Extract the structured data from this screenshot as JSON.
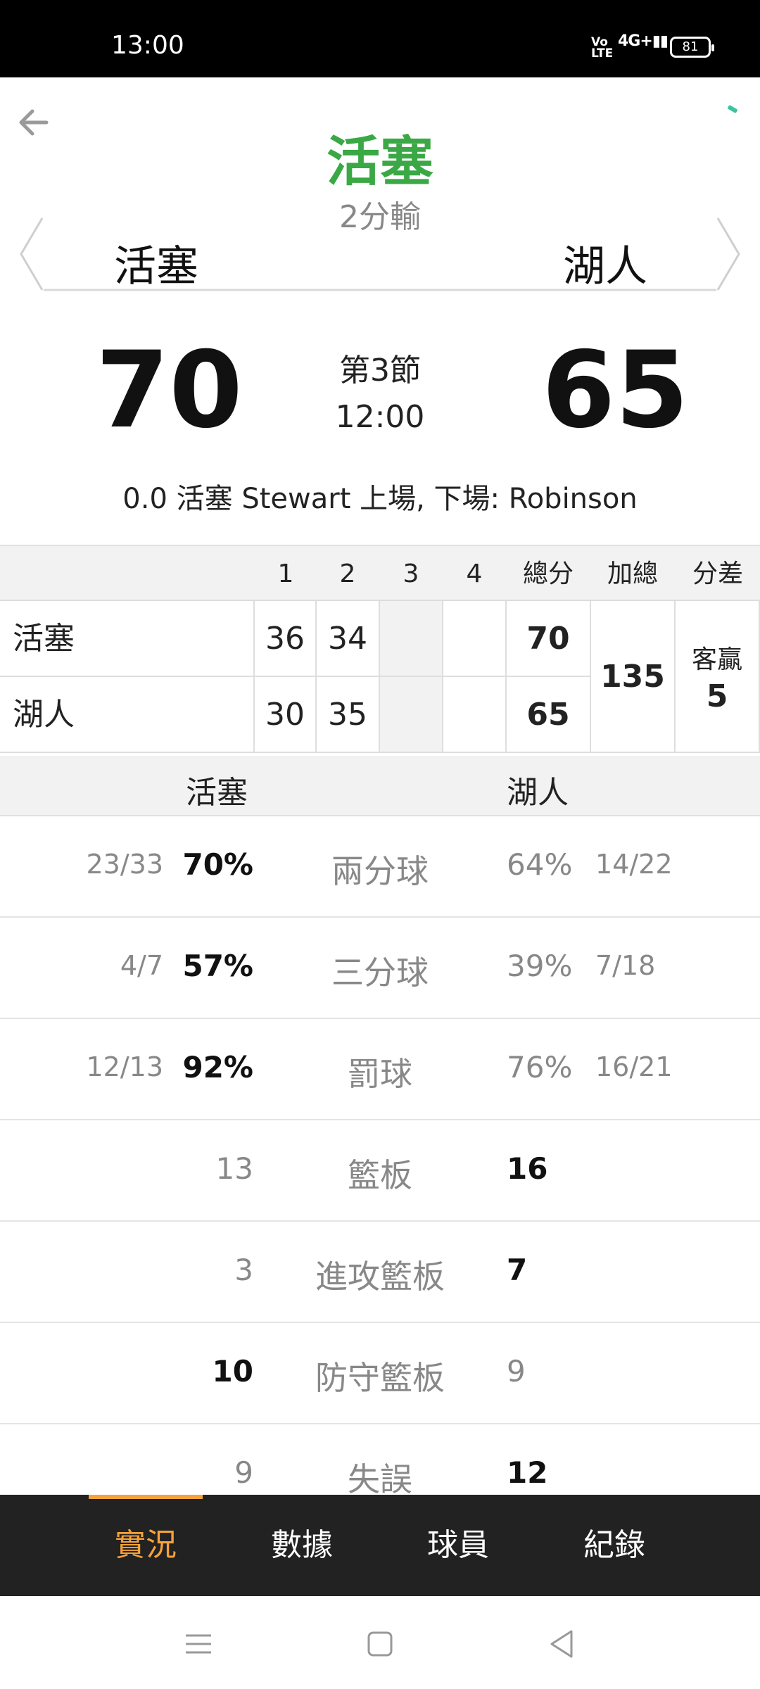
{
  "status_bar": {
    "time": "13:00",
    "volte": "Vo LTE",
    "network": "4G+",
    "battery": "81"
  },
  "header": {
    "leading_team": "活塞",
    "margin_text": "2分輸",
    "team_left": "活塞",
    "team_right": "湖人"
  },
  "score": {
    "left": "70",
    "right": "65",
    "period": "第3節",
    "clock": "12:00"
  },
  "event_text": "0.0 活塞 Stewart 上場, 下場: Robinson",
  "period_table": {
    "headers": [
      "1",
      "2",
      "3",
      "4",
      "總分",
      "加總",
      "分差"
    ],
    "rows": [
      {
        "team": "活塞",
        "q1": "36",
        "q2": "34",
        "q3": "",
        "q4": "",
        "total": "70"
      },
      {
        "team": "湖人",
        "q1": "30",
        "q2": "35",
        "q3": "",
        "q4": "",
        "total": "65"
      }
    ],
    "sum": "135",
    "diff_label": "客贏",
    "diff_value": "5"
  },
  "stats": {
    "team_left": "活塞",
    "team_right": "湖人",
    "rows": [
      {
        "label": "兩分球",
        "left_frac": "23/33",
        "left_val": "70%",
        "right_val": "64%",
        "right_frac": "14/22",
        "lead": "left"
      },
      {
        "label": "三分球",
        "left_frac": "4/7",
        "left_val": "57%",
        "right_val": "39%",
        "right_frac": "7/18",
        "lead": "left"
      },
      {
        "label": "罰球",
        "left_frac": "12/13",
        "left_val": "92%",
        "right_val": "76%",
        "right_frac": "16/21",
        "lead": "left"
      },
      {
        "label": "籃板",
        "left_frac": "",
        "left_val": "13",
        "right_val": "16",
        "right_frac": "",
        "lead": "right"
      },
      {
        "label": "進攻籃板",
        "left_frac": "",
        "left_val": "3",
        "right_val": "7",
        "right_frac": "",
        "lead": "right"
      },
      {
        "label": "防守籃板",
        "left_frac": "",
        "left_val": "10",
        "right_val": "9",
        "right_frac": "",
        "lead": "left"
      },
      {
        "label": "失誤",
        "left_frac": "",
        "left_val": "9",
        "right_val": "12",
        "right_frac": "",
        "lead": "right"
      }
    ]
  },
  "bottom_nav": {
    "tabs": [
      "實況",
      "數據",
      "球員",
      "紀錄"
    ],
    "active_index": 0
  },
  "colors": {
    "leader_green": "#3aa845",
    "accent_orange": "#f5a23a",
    "nav_dark": "#222222"
  }
}
